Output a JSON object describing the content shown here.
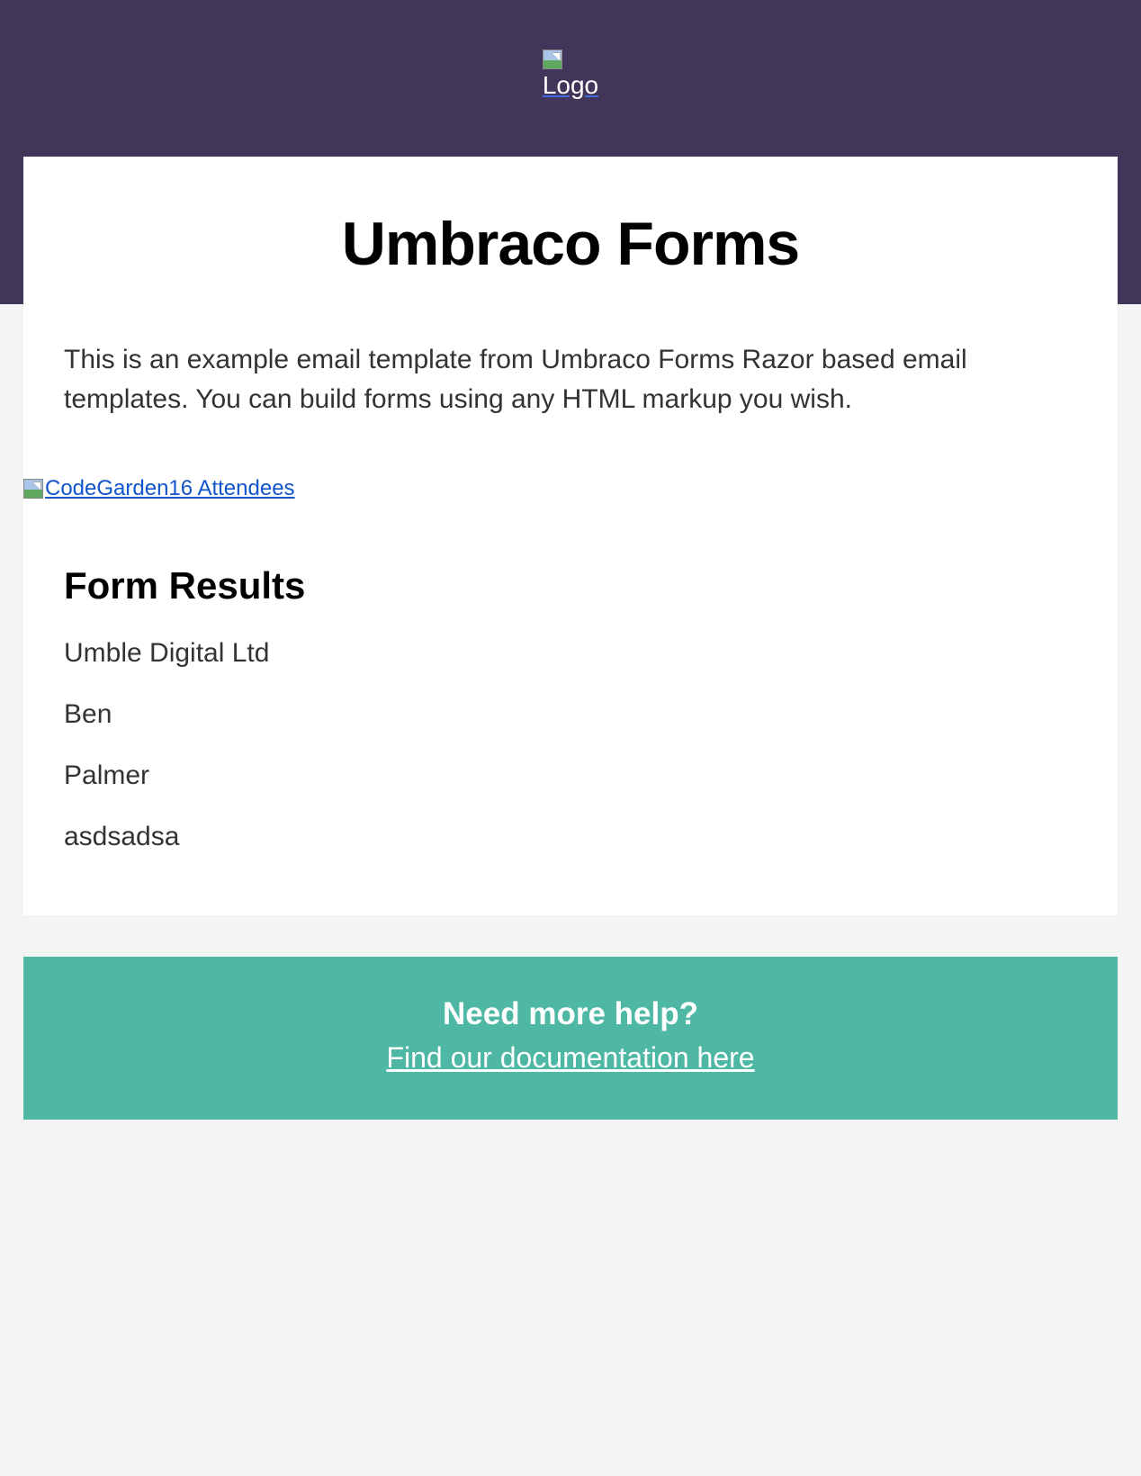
{
  "header": {
    "logo_alt": "Logo"
  },
  "main": {
    "title": "Umbraco Forms",
    "intro": "This is an example email template from Umbraco Forms Razor based email templates. You can build forms using any HTML markup you wish.",
    "attendees_alt": "CodeGarden16 Attendees",
    "results_heading": "Form Results",
    "results": [
      "Umble Digital Ltd",
      "Ben",
      "Palmer",
      "asdsadsa"
    ]
  },
  "help": {
    "title": "Need more help?",
    "link_text": "Find our documentation here"
  }
}
